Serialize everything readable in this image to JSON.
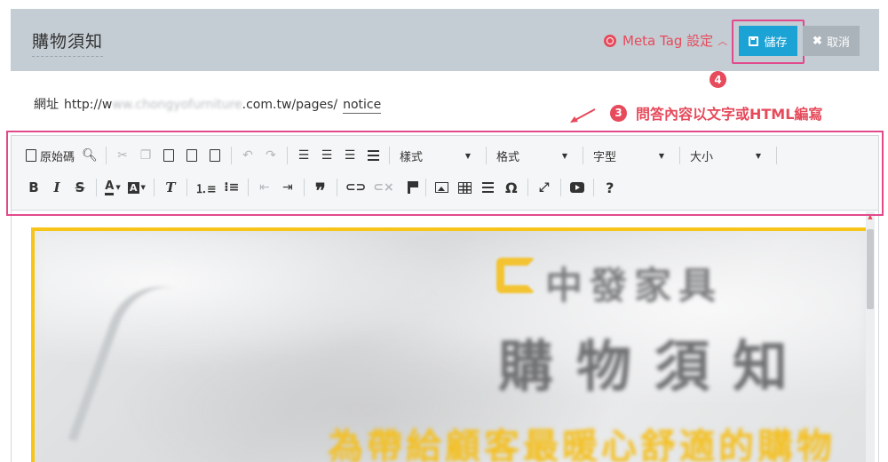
{
  "header": {
    "title": "購物須知",
    "meta_tag_label": "Meta Tag 設定",
    "save_label": "儲存",
    "cancel_label": "取消"
  },
  "url": {
    "prefix": "網址",
    "start": "http://w",
    "blurred": "ww.chongyofurniture",
    "domain_tail": ".com.tw/pages/",
    "slug": "notice"
  },
  "annotations": {
    "badge_3": "3",
    "badge_4": "4",
    "note_text": "問答內容以文字或HTML編寫",
    "accent_color": "#e64a5b",
    "highlight_color": "#e2498c"
  },
  "toolbar": {
    "source_label": "原始碼",
    "style_combo": "樣式",
    "format_combo": "格式",
    "font_combo": "字型",
    "size_combo": "大小",
    "icons_row1": [
      "source-icon",
      "preview-icon",
      "cut-icon",
      "copy-icon",
      "paste-icon",
      "paste-text-icon",
      "paste-word-icon",
      "undo-icon",
      "redo-icon",
      "align-left-icon",
      "align-center-icon",
      "align-right-icon",
      "justify-icon"
    ],
    "icons_row2": [
      "bold-icon",
      "italic-icon",
      "strike-icon",
      "text-color-icon",
      "bg-color-icon",
      "remove-format-icon",
      "numbered-list-icon",
      "bullet-list-icon",
      "outdent-icon",
      "indent-icon",
      "blockquote-icon",
      "link-icon",
      "unlink-icon",
      "anchor-icon",
      "image-icon",
      "table-icon",
      "horizontal-rule-icon",
      "special-char-icon",
      "maximize-icon",
      "youtube-icon",
      "help-icon"
    ],
    "bold_glyph": "B",
    "italic_glyph": "I",
    "strike_glyph": "S",
    "text_color_glyph": "A",
    "bg_color_glyph": "A",
    "remove_format_glyph": "T",
    "quote_glyph": "❞",
    "omega_glyph": "Ω",
    "help_glyph": "?"
  },
  "banner": {
    "brand_text": "中發家具",
    "title_text": "購物須知",
    "slogan_text": "為帶給顧客最暖心舒適的購物"
  },
  "colors": {
    "header_bg": "#c5cdd4",
    "save_btn": "#1ba3d6",
    "cancel_btn": "#aab3ba",
    "banner_border": "#f7c518"
  }
}
